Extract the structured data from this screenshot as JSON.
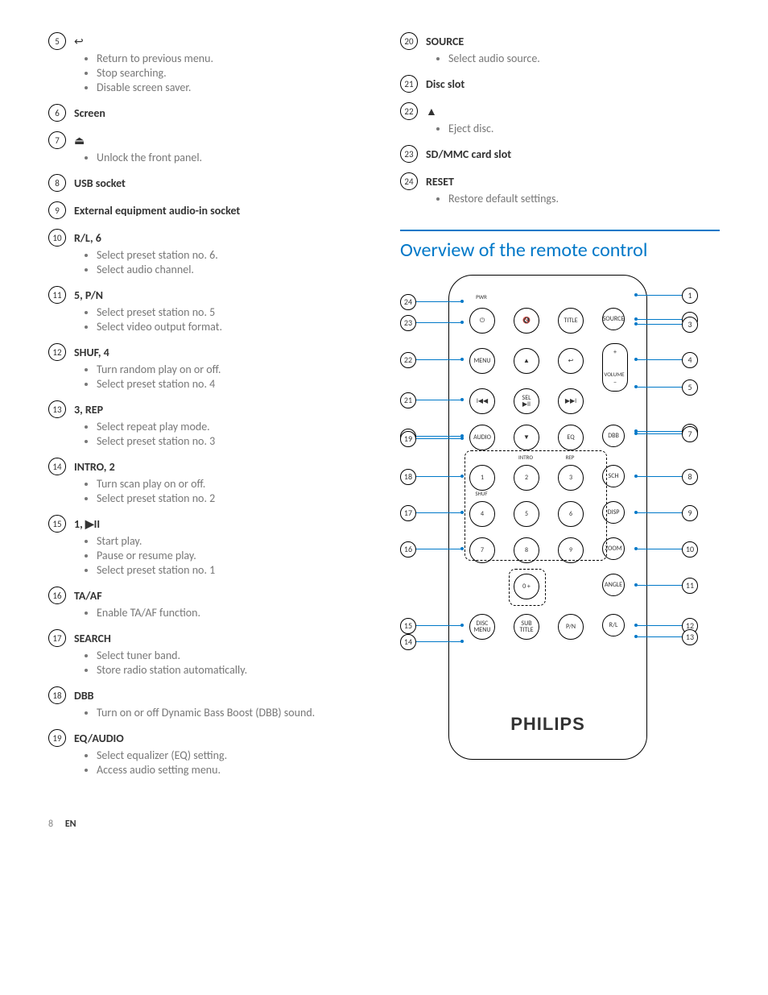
{
  "left_items": [
    {
      "num": "5",
      "icon": "↩",
      "title": "",
      "bullets": [
        "Return to previous menu.",
        "Stop searching.",
        "Disable screen saver."
      ]
    },
    {
      "num": "6",
      "title": "Screen",
      "bullets": []
    },
    {
      "num": "7",
      "icon": "⏏",
      "title": "",
      "bullets": [
        "Unlock the front panel."
      ]
    },
    {
      "num": "8",
      "title": "USB socket",
      "bullets": []
    },
    {
      "num": "9",
      "title": "External equipment audio-in socket",
      "bullets": []
    },
    {
      "num": "10",
      "title": "R/L, 6",
      "bullets": [
        "Select preset station no. 6.",
        "Select audio channel."
      ]
    },
    {
      "num": "11",
      "title": "5, P/N",
      "bullets": [
        "Select preset station no. 5",
        "Select video output format."
      ]
    },
    {
      "num": "12",
      "title": "SHUF, 4",
      "bullets": [
        "Turn random play on or off.",
        "Select preset station no. 4"
      ]
    },
    {
      "num": "13",
      "title": "3, REP",
      "bullets": [
        "Select repeat play mode.",
        "Select preset station no. 3"
      ]
    },
    {
      "num": "14",
      "title": "INTRO, 2",
      "bullets": [
        "Turn scan play on or off.",
        "Select preset station no. 2"
      ]
    },
    {
      "num": "15",
      "title": "1, ▶II",
      "bullets": [
        "Start play.",
        "Pause or resume play.",
        "Select preset station no. 1"
      ]
    },
    {
      "num": "16",
      "title": "TA/AF",
      "bullets": [
        "Enable TA/AF function."
      ]
    },
    {
      "num": "17",
      "title": "SEARCH",
      "bullets": [
        "Select tuner band.",
        "Store radio station automatically."
      ]
    },
    {
      "num": "18",
      "title": "DBB",
      "bullets": [
        "Turn on or off Dynamic Bass Boost (DBB) sound."
      ]
    },
    {
      "num": "19",
      "title": "EQ/AUDIO",
      "bullets": [
        "Select equalizer (EQ) setting.",
        "Access audio setting menu."
      ]
    }
  ],
  "right_items": [
    {
      "num": "20",
      "title": "SOURCE",
      "bullets": [
        "Select audio source."
      ]
    },
    {
      "num": "21",
      "title": "Disc slot",
      "bullets": []
    },
    {
      "num": "22",
      "icon": "▲",
      "title": "",
      "bullets": [
        "Eject disc."
      ]
    },
    {
      "num": "23",
      "title": "SD/MMC card slot",
      "bullets": []
    },
    {
      "num": "24",
      "title": "RESET",
      "bullets": [
        "Restore default settings."
      ]
    }
  ],
  "section_heading": "Overview of the remote control",
  "remote": {
    "brand": "PHILIPS",
    "labels": {
      "pwr": "PWR",
      "volume": "VOLUME",
      "intro": "INTRO",
      "rep": "REP",
      "shuf": "SHUF"
    },
    "buttons": {
      "power": "⏻",
      "mute": "🔇",
      "title": "TITLE",
      "source": "SOURCE",
      "menu": "MENU",
      "up": "▲",
      "back": "↩",
      "plus": "+",
      "minus": "−",
      "prev": "I◀◀",
      "sel": "SEL\n▶II",
      "next": "▶▶I",
      "audio": "AUDIO",
      "down": "▼",
      "eq": "EQ",
      "dbb": "DBB",
      "n1": "1",
      "n2": "2",
      "n3": "3",
      "sch": "SCH",
      "n4": "4",
      "n5": "5",
      "n6": "6",
      "disp": "DISP",
      "n7": "7",
      "n8": "8",
      "n9": "9",
      "zoom": "ZOOM",
      "n0": "0 +",
      "angle": "ANGLE",
      "discmenu": "DISC\nMENU",
      "subtitle": "SUB\nTITLE",
      "pn": "P/N",
      "rl": "R/L"
    },
    "callouts_left": [
      "24",
      "23",
      "22",
      "21",
      "20",
      "19",
      "18",
      "17",
      "16",
      "15",
      "14"
    ],
    "callouts_right": [
      "1",
      "2",
      "3",
      "4",
      "5",
      "6",
      "7",
      "8",
      "9",
      "10",
      "11",
      "12",
      "13"
    ]
  },
  "footer": {
    "page": "8",
    "lang": "EN"
  }
}
